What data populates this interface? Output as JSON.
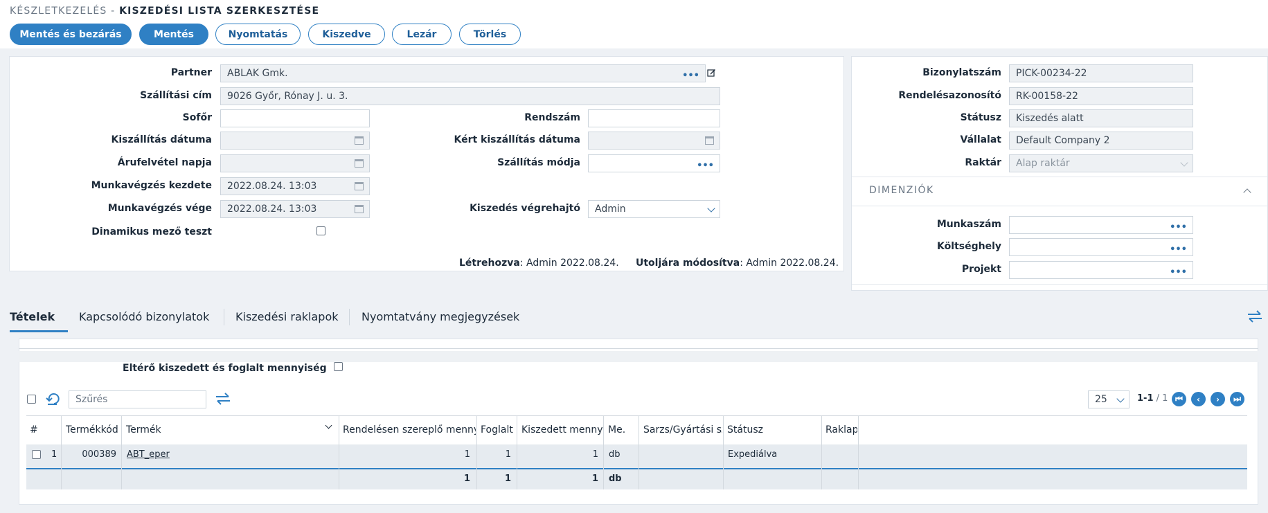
{
  "header": {
    "breadcrumb_parent": "KÉSZLETKEZELÉS -",
    "title": "KISZEDÉSI LISTA SZERKESZTÉSE"
  },
  "toolbar": {
    "save_close": "Mentés és bezárás",
    "save": "Mentés",
    "print": "Nyomtatás",
    "picked": "Kiszedve",
    "close": "Lezár",
    "delete": "Törlés"
  },
  "form": {
    "partner_label": "Partner",
    "partner_value": "ABLAK Gmk.",
    "address_label": "Szállítási cím",
    "address_value": "9026 Győr, Rónay J. u. 3.",
    "driver_label": "Sofőr",
    "driver_value": "",
    "plate_label": "Rendszám",
    "plate_value": "",
    "delivery_date_label": "Kiszállítás dátuma",
    "delivery_date_value": "",
    "requested_date_label": "Kért kiszállítás dátuma",
    "requested_date_value": "",
    "pickup_day_label": "Árufelvétel napja",
    "pickup_day_value": "",
    "shipping_mode_label": "Szállítás módja",
    "shipping_mode_value": "",
    "work_start_label": "Munkavégzés kezdete",
    "work_start_value": "2022.08.24. 13:03",
    "work_end_label": "Munkavégzés vége",
    "work_end_value": "2022.08.24. 13:03",
    "picker_label": "Kiszedés végrehajtó",
    "picker_value": "Admin",
    "dynamic_label": "Dinamikus mező teszt",
    "created_label": "Létrehozva",
    "created_value": ": Admin 2022.08.24.",
    "modified_label": "Utoljára módosítva",
    "modified_value": ": Admin 2022.08.24."
  },
  "side": {
    "doc_no_label": "Bizonylatszám",
    "doc_no_value": "PICK-00234-22",
    "order_id_label": "Rendelésazonosító",
    "order_id_value": "RK-00158-22",
    "status_label": "Státusz",
    "status_value": "Kiszedés alatt",
    "company_label": "Vállalat",
    "company_value": "Default Company 2",
    "warehouse_label": "Raktár",
    "warehouse_value": "Alap raktár",
    "dimensions_title": "DIMENZIÓK",
    "job_label": "Munkaszám",
    "job_value": "",
    "cost_label": "Költséghely",
    "cost_value": "",
    "project_label": "Projekt",
    "project_value": ""
  },
  "tabs": [
    "Tételek",
    "Kapcsolódó bizonylatok",
    "Kiszedési raklapok",
    "Nyomtatvány megjegyzések"
  ],
  "items": {
    "diff_label": "Eltérő kiszedett és foglalt mennyiség",
    "filter_placeholder": "Szűrés",
    "page_size": "25",
    "range": "1-1",
    "total_pages": "/ 1",
    "columns": [
      "#",
      "Termékkód",
      "Termék",
      "Rendelésen szereplő menny",
      "Foglalt",
      "Kiszedett menny",
      "Me.",
      "Sarzs/Gyártási sz",
      "Státusz",
      "Raklap"
    ],
    "rows": [
      {
        "no": "1",
        "code": "000389",
        "product": "ABT_eper",
        "ordered": "1",
        "reserved": "1",
        "picked": "1",
        "unit": "db",
        "batch": "",
        "status": "Expediálva",
        "pallet": ""
      }
    ],
    "totals": {
      "ordered": "1",
      "reserved": "1",
      "picked": "1",
      "unit": "db"
    }
  }
}
